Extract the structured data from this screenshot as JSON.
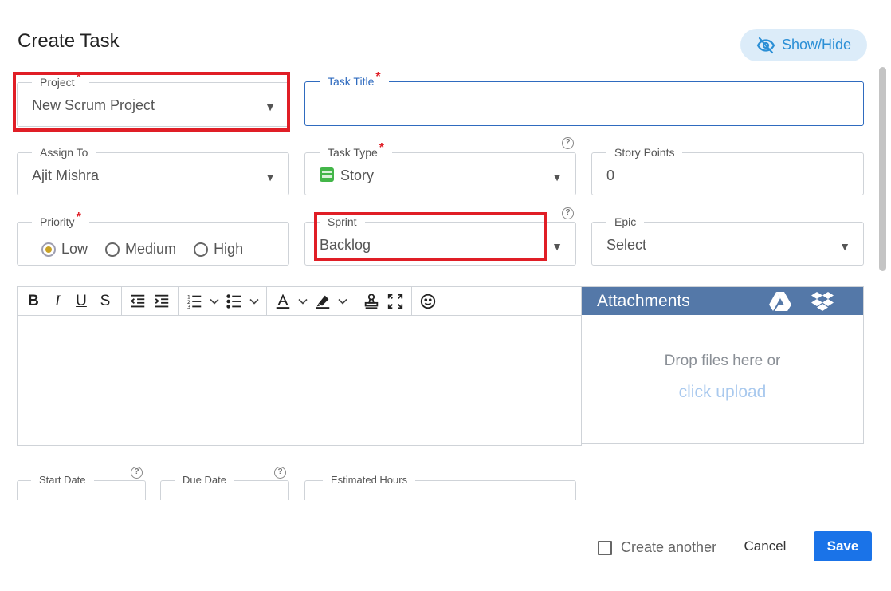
{
  "dialog": {
    "title": "Create Task",
    "show_hide_label": "Show/Hide"
  },
  "fields": {
    "project": {
      "label": "Project",
      "value": "New Scrum Project"
    },
    "task_title": {
      "label": "Task Title",
      "value": ""
    },
    "assign_to": {
      "label": "Assign To",
      "value": "Ajit Mishra"
    },
    "task_type": {
      "label": "Task Type",
      "value": "Story"
    },
    "story_points": {
      "label": "Story Points",
      "value": "0"
    },
    "priority": {
      "label": "Priority",
      "options": [
        "Low",
        "Medium",
        "High"
      ],
      "selected": "Low"
    },
    "sprint": {
      "label": "Sprint",
      "value": "Backlog"
    },
    "epic": {
      "label": "Epic",
      "value": "Select"
    },
    "start_date": {
      "label": "Start Date"
    },
    "due_date": {
      "label": "Due Date"
    },
    "estimated_hours": {
      "label": "Estimated Hours"
    }
  },
  "help_glyph": "?",
  "required_mark": "*",
  "attachments": {
    "title": "Attachments",
    "drop_text": "Drop files here or",
    "upload_link": "click upload"
  },
  "footer": {
    "create_another": "Create another",
    "cancel": "Cancel",
    "save": "Save"
  },
  "colors": {
    "accent": "#1a73e8",
    "highlight": "#e01e26",
    "attachments_header": "#5478a8",
    "show_hide_bg": "#dcecf9"
  }
}
